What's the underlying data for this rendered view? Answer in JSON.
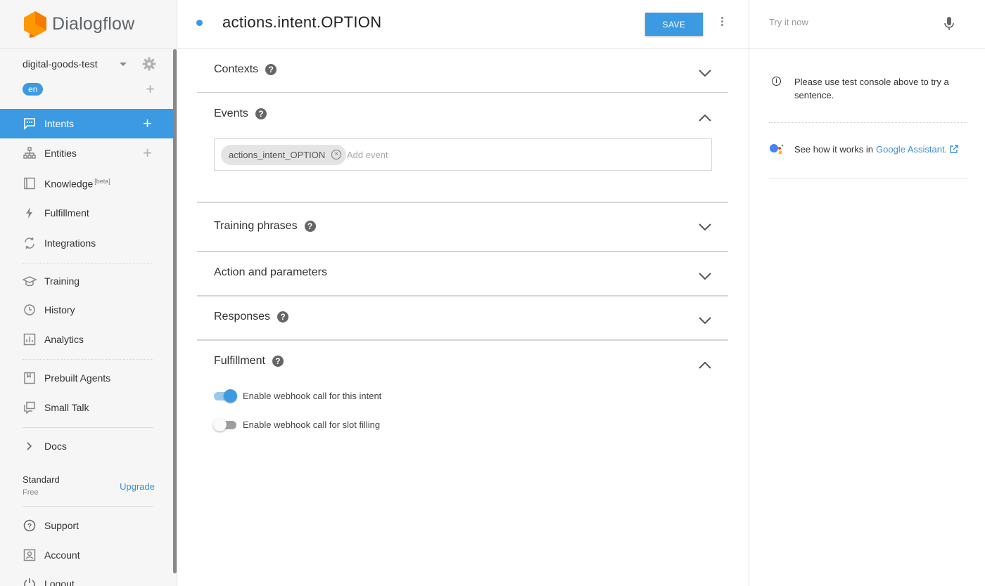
{
  "brand": {
    "name": "Dialogflow"
  },
  "agent": {
    "name": "digital-goods-test",
    "language": "en"
  },
  "sidebar": {
    "items": [
      {
        "label": "Intents",
        "icon": "chat-bubble-icon",
        "active": true
      },
      {
        "label": "Entities",
        "icon": "hierarchy-icon"
      },
      {
        "label": "Knowledge",
        "icon": "book-icon",
        "badge": "[beta]"
      },
      {
        "label": "Fulfillment",
        "icon": "lightning-icon"
      },
      {
        "label": "Integrations",
        "icon": "sync-icon"
      },
      {
        "label": "Training",
        "icon": "graduation-cap-icon"
      },
      {
        "label": "History",
        "icon": "clock-icon"
      },
      {
        "label": "Analytics",
        "icon": "bar-chart-icon"
      },
      {
        "label": "Prebuilt Agents",
        "icon": "bookmark-book-icon"
      },
      {
        "label": "Small Talk",
        "icon": "chat-squares-icon"
      },
      {
        "label": "Docs",
        "icon": "chevron-right-icon"
      },
      {
        "label": "Support",
        "icon": "help-circle-icon"
      },
      {
        "label": "Account",
        "icon": "account-icon"
      },
      {
        "label": "Logout",
        "icon": "power-icon"
      }
    ],
    "plan": {
      "name": "Standard",
      "tier": "Free",
      "upgrade_label": "Upgrade"
    }
  },
  "header": {
    "intent_name": "actions.intent.OPTION",
    "save_label": "SAVE"
  },
  "sections": {
    "contexts": {
      "title": "Contexts",
      "expanded": false
    },
    "events": {
      "title": "Events",
      "expanded": true,
      "chips": [
        "actions_intent_OPTION"
      ],
      "add_placeholder": "Add event"
    },
    "training": {
      "title": "Training phrases",
      "expanded": false
    },
    "action": {
      "title": "Action and parameters",
      "expanded": false
    },
    "responses": {
      "title": "Responses",
      "expanded": false
    },
    "fulfillment": {
      "title": "Fulfillment",
      "expanded": true,
      "webhook_label": "Enable webhook call for this intent",
      "webhook_enabled": true,
      "slot_label": "Enable webhook call for slot filling",
      "slot_enabled": false
    }
  },
  "right_panel": {
    "try_placeholder": "Try it now",
    "info_message": "Please use test console above to try a sentence.",
    "ga_text": "See how it works in",
    "ga_link": "Google Assistant."
  },
  "colors": {
    "accent": "#3b9ae1",
    "link": "#3b8fd9",
    "brand_orange": "#f57c00"
  }
}
